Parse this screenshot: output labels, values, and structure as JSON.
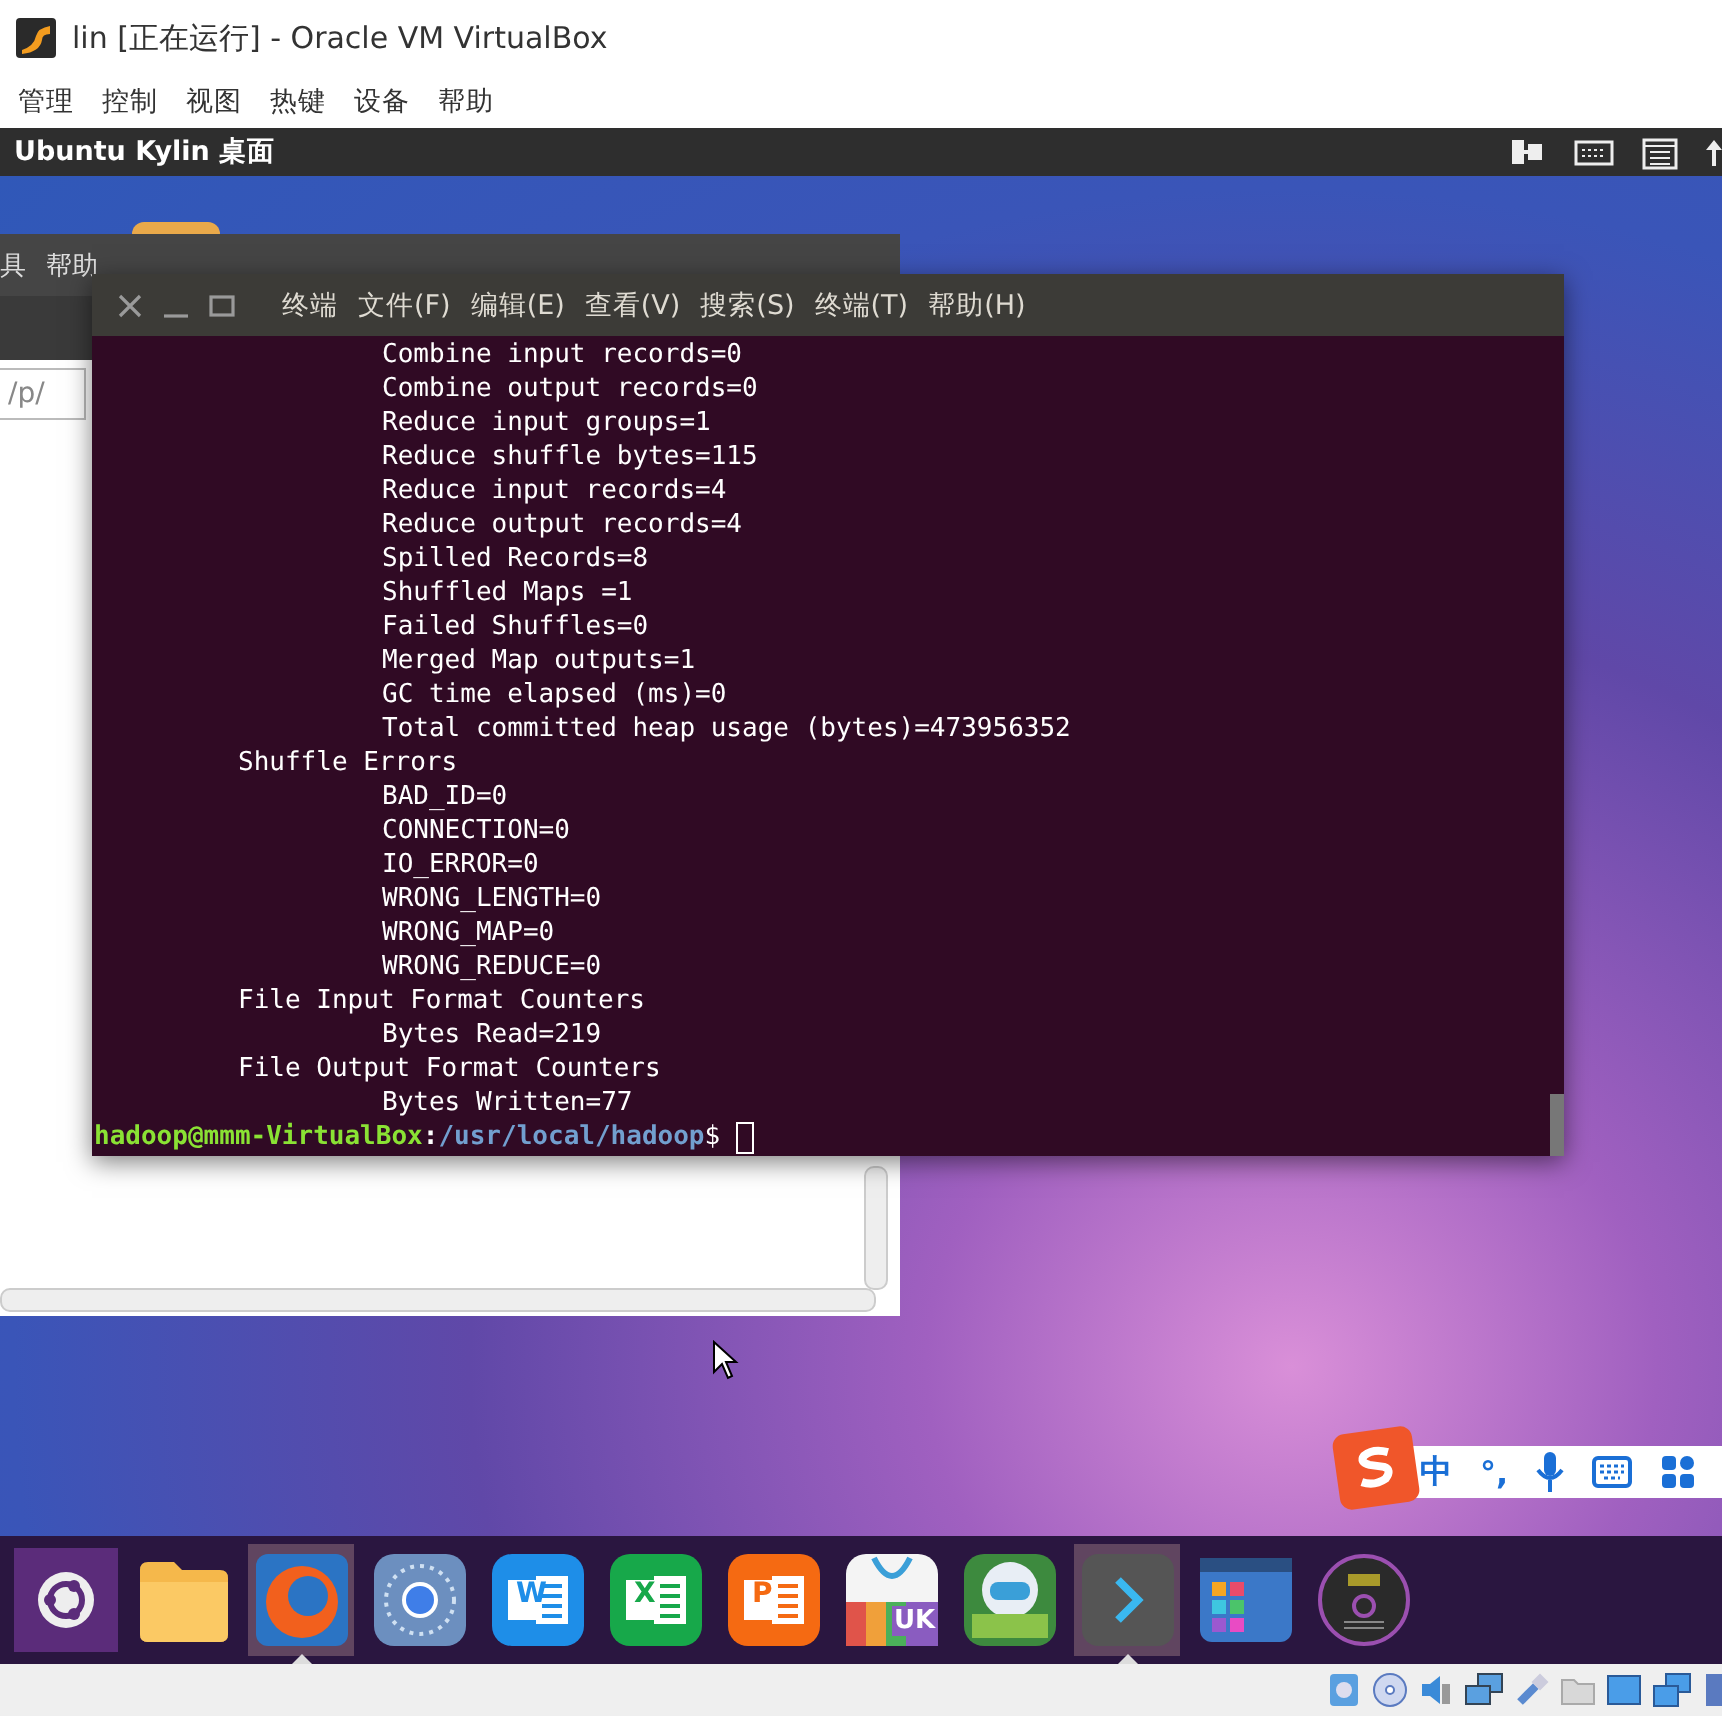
{
  "window": {
    "title": "lin [正在运行] - Oracle VM VirtualBox"
  },
  "menu": [
    "管理",
    "控制",
    "视图",
    "热键",
    "设备",
    "帮助"
  ],
  "vm_bar": {
    "title": "Ubuntu Kylin 桌面"
  },
  "background_window": {
    "menu": [
      "具",
      "帮助"
    ],
    "address": "/p/"
  },
  "terminal": {
    "menu": [
      "终端",
      "文件(F)",
      "编辑(E)",
      "查看(V)",
      "搜索(S)",
      "终端(T)",
      "帮助(H)"
    ],
    "lines": [
      {
        "kind": "counter",
        "text": "Combine input records=0"
      },
      {
        "kind": "counter",
        "text": "Combine output records=0"
      },
      {
        "kind": "counter",
        "text": "Reduce input groups=1"
      },
      {
        "kind": "counter",
        "text": "Reduce shuffle bytes=115"
      },
      {
        "kind": "counter",
        "text": "Reduce input records=4"
      },
      {
        "kind": "counter",
        "text": "Reduce output records=4"
      },
      {
        "kind": "counter",
        "text": "Spilled Records=8"
      },
      {
        "kind": "counter",
        "text": "Shuffled Maps =1"
      },
      {
        "kind": "counter",
        "text": "Failed Shuffles=0"
      },
      {
        "kind": "counter",
        "text": "Merged Map outputs=1"
      },
      {
        "kind": "counter",
        "text": "GC time elapsed (ms)=0"
      },
      {
        "kind": "counter",
        "text": "Total committed heap usage (bytes)=473956352"
      },
      {
        "kind": "group",
        "text": "Shuffle Errors"
      },
      {
        "kind": "counter",
        "text": "BAD_ID=0"
      },
      {
        "kind": "counter",
        "text": "CONNECTION=0"
      },
      {
        "kind": "counter",
        "text": "IO_ERROR=0"
      },
      {
        "kind": "counter",
        "text": "WRONG_LENGTH=0"
      },
      {
        "kind": "counter",
        "text": "WRONG_MAP=0"
      },
      {
        "kind": "counter",
        "text": "WRONG_REDUCE=0"
      },
      {
        "kind": "group",
        "text": "File Input Format Counters"
      },
      {
        "kind": "counter",
        "text": "Bytes Read=219"
      },
      {
        "kind": "group",
        "text": "File Output Format Counters"
      },
      {
        "kind": "counter",
        "text": "Bytes Written=77"
      }
    ],
    "prompt": {
      "user": "hadoop@mmm-VirtualBox",
      "separator": ":",
      "path": "/usr/local/hadoop",
      "symbol": "$"
    }
  },
  "ime": {
    "items": [
      "中",
      "°,"
    ]
  },
  "dock": [
    {
      "kind": "ubuntu",
      "running": false
    },
    {
      "kind": "folder",
      "running": false
    },
    {
      "kind": "firefox",
      "running": true
    },
    {
      "kind": "chromium",
      "running": false
    },
    {
      "kind": "word",
      "running": false,
      "letter": "W"
    },
    {
      "kind": "excel",
      "running": false,
      "letter": "X"
    },
    {
      "kind": "powerpoint",
      "running": false,
      "letter": "P"
    },
    {
      "kind": "store",
      "running": false,
      "letter": "UK"
    },
    {
      "kind": "robot",
      "running": false
    },
    {
      "kind": "terminal",
      "running": true
    },
    {
      "kind": "workspaces",
      "running": false
    },
    {
      "kind": "disc",
      "running": false
    }
  ]
}
